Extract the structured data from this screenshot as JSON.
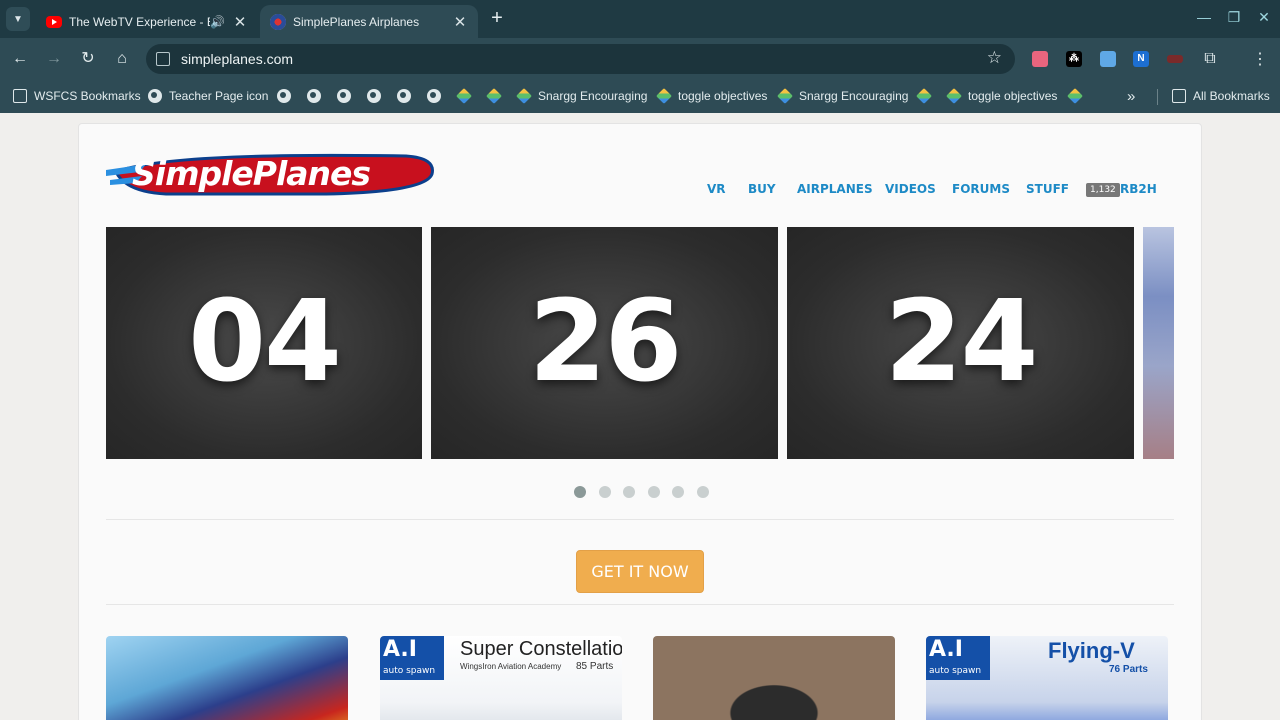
{
  "tabs": [
    {
      "title": "The WebTV Experience - Ex",
      "audio": "🔊",
      "close": "✕"
    },
    {
      "title": "SimplePlanes Airplanes",
      "close": "✕"
    }
  ],
  "toolbar": {
    "url": "simpleplanes.com",
    "ext_n": "N"
  },
  "bookmarks": {
    "items": [
      {
        "label": "WSFCS Bookmarks"
      },
      {
        "label": "Teacher Page icon"
      },
      {
        "label": "Snargg Encouraging"
      },
      {
        "label": "toggle objectives"
      },
      {
        "label": "Snargg Encouraging"
      },
      {
        "label": "toggle objectives"
      }
    ],
    "overflow": "»",
    "all": "All Bookmarks"
  },
  "site": {
    "logo_simple": "Simple",
    "logo_planes": "Planes",
    "nav": [
      "VR",
      "BUY",
      "AIRPLANES",
      "VIDEOS",
      "FORUMS",
      "STUFF"
    ],
    "points_badge": "1,132",
    "username": "RB2H",
    "countdown": [
      "04",
      "26",
      "24"
    ],
    "carousel_dots": 6,
    "carousel_active": 0,
    "cta": "GET IT NOW",
    "thumbnails": [
      {
        "title": ""
      },
      {
        "ai": "A.I",
        "ai_sub": "auto spawn",
        "title": "Super Constellation",
        "subtitle": "WingsIron Aviation Academy",
        "parts": "85 Parts"
      },
      {
        "title": ""
      },
      {
        "ai": "A.I",
        "ai_sub": "auto spawn",
        "title": "Flying-V",
        "parts": "76 Parts"
      }
    ]
  },
  "colors": {
    "chrome_bg": "#1f3a43",
    "toolbar_bg": "#2e4b55",
    "nav_link": "#1d8ac6",
    "cta": "#f0ad4e"
  }
}
